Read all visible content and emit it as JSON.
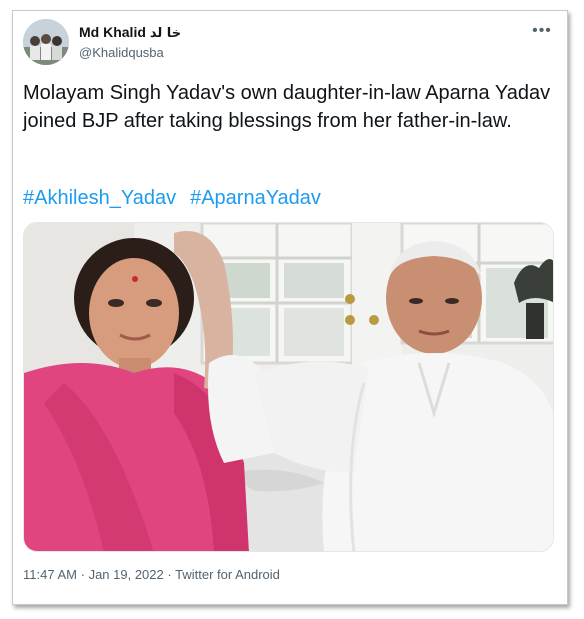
{
  "tweet": {
    "author": {
      "display_name": "Md Khalid",
      "display_name_urdu": "خا لد",
      "handle": "@Khalidqusba"
    },
    "more_icon": "ellipsis-icon",
    "text": "Molayam Singh Yadav's own daughter-in-law Aparna Yadav joined BJP after taking blessings from her father-in-law.",
    "hashtags": [
      "#Akhilesh_Yadav",
      "#AparnaYadav"
    ],
    "time": "11:47 AM",
    "date": "Jan 19, 2022",
    "source": "Twitter for Android",
    "separator": "·"
  },
  "colors": {
    "text": "#0f1419",
    "secondary": "#536471",
    "link": "#1d9bf0",
    "saree": "#e0457f"
  }
}
